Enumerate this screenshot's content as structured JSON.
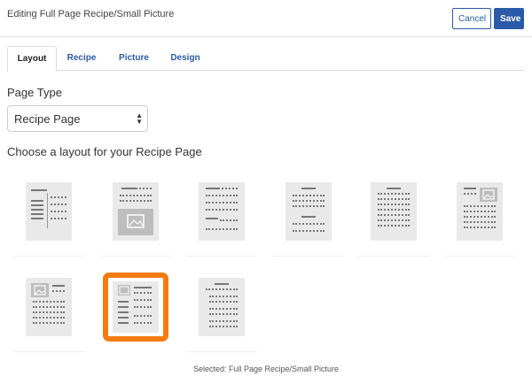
{
  "header": {
    "title": "Editing Full Page Recipe/Small Picture",
    "cancel_label": "Cancel",
    "save_label": "Save"
  },
  "tabs": [
    {
      "label": "Layout"
    },
    {
      "label": "Recipe"
    },
    {
      "label": "Picture"
    },
    {
      "label": "Design"
    }
  ],
  "page_type": {
    "label": "Page Type",
    "selected": "Recipe Page"
  },
  "layouts": {
    "heading": "Choose a layout for your Recipe Page",
    "selected_text": "Selected: Full Page Recipe/Small Picture"
  },
  "colors": {
    "accent": "#2b5ba8",
    "selection": "#f47b10"
  }
}
